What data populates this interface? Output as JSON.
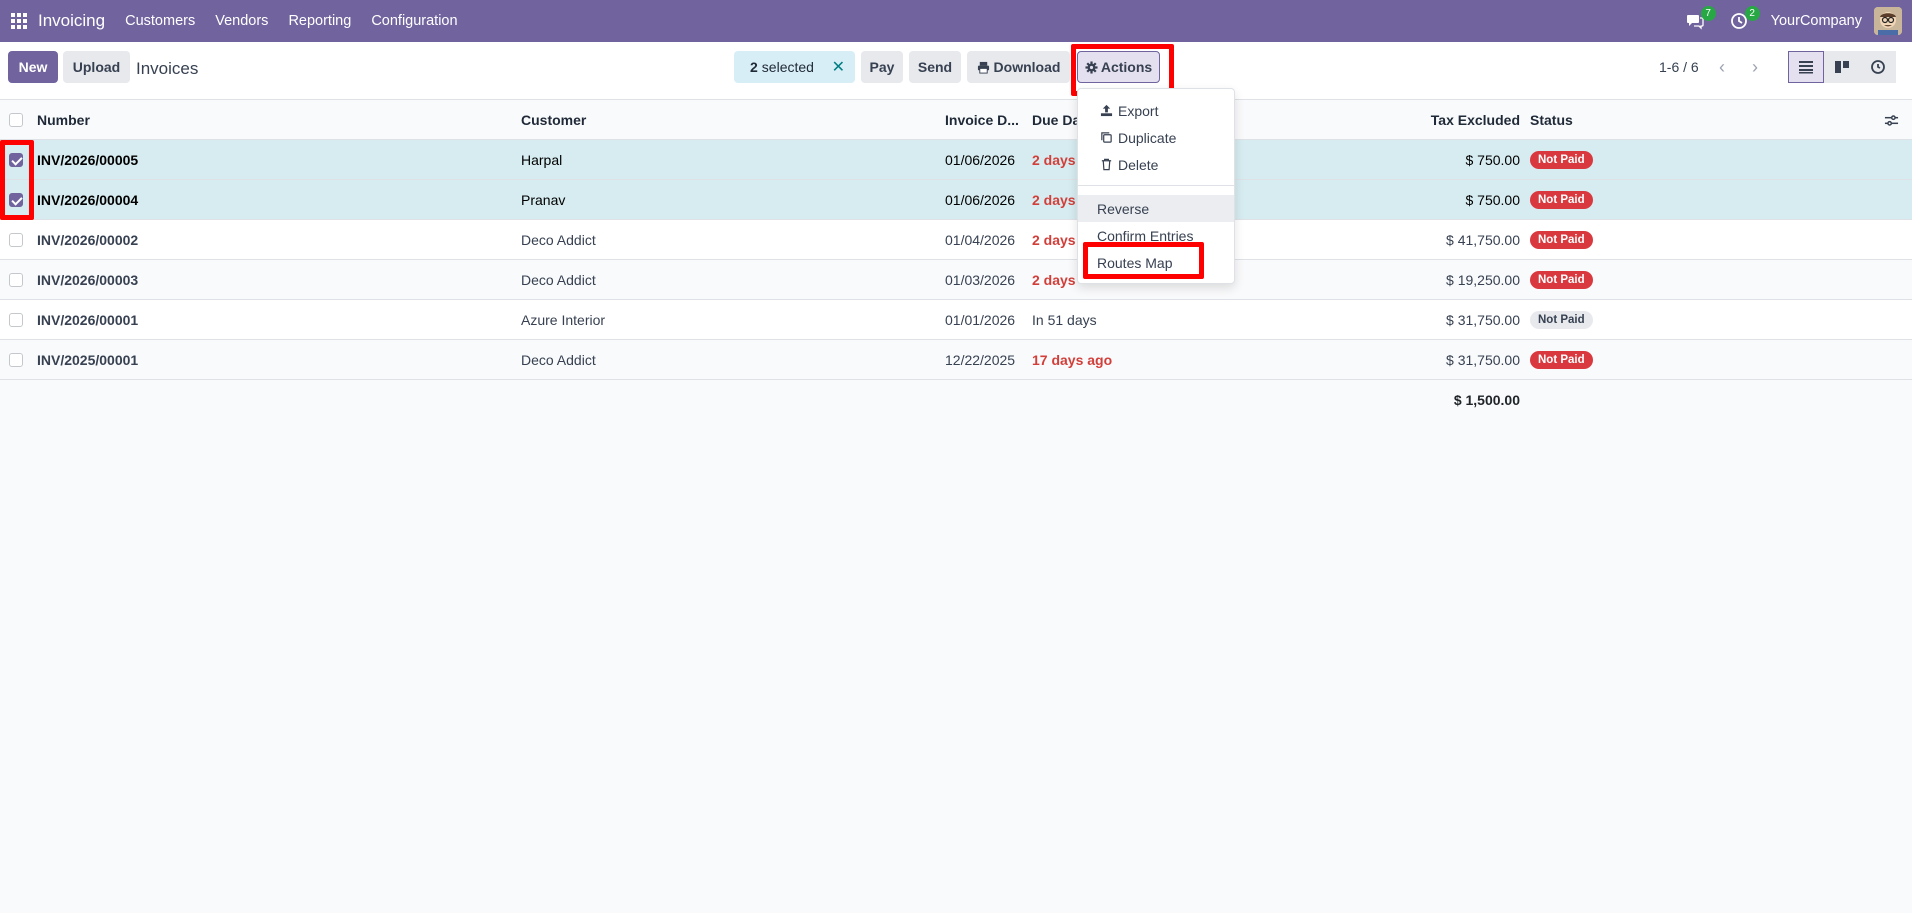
{
  "navbar": {
    "brand": "Invoicing",
    "menu": [
      "Customers",
      "Vendors",
      "Reporting",
      "Configuration"
    ],
    "messages_count": "7",
    "activities_count": "2",
    "company": "YourCompany"
  },
  "control": {
    "new_label": "New",
    "upload_label": "Upload",
    "title": "Invoices",
    "selected_count": "2",
    "selected_text": "selected",
    "pay_label": "Pay",
    "send_label": "Send",
    "download_label": "Download",
    "actions_label": "Actions",
    "pager": "1-6 / 6"
  },
  "table": {
    "headers": {
      "number": "Number",
      "customer": "Customer",
      "invoice_date": "Invoice D...",
      "due_date": "Due Da",
      "tax_excluded": "Tax Excluded",
      "status": "Status"
    },
    "rows": [
      {
        "number": "INV/2026/00005",
        "customer": "Harpal",
        "invoice_date": "01/06/2026",
        "due": "2 days",
        "tax": "$ 750.00",
        "status": "Not Paid",
        "checked": true
      },
      {
        "number": "INV/2026/00004",
        "customer": "Pranav",
        "invoice_date": "01/06/2026",
        "due": "2 days",
        "tax": "$ 750.00",
        "status": "Not Paid",
        "checked": true
      },
      {
        "number": "INV/2026/00002",
        "customer": "Deco Addict",
        "invoice_date": "01/04/2026",
        "due": "2 days",
        "tax": "$ 41,750.00",
        "status": "Not Paid",
        "checked": false
      },
      {
        "number": "INV/2026/00003",
        "customer": "Deco Addict",
        "invoice_date": "01/03/2026",
        "due": "2 days",
        "tax": "$ 19,250.00",
        "status": "Not Paid",
        "checked": false
      },
      {
        "number": "INV/2026/00001",
        "customer": "Azure Interior",
        "invoice_date": "01/01/2026",
        "due": "In 51 days",
        "tax": "$ 31,750.00",
        "status": "Not Paid",
        "checked": false
      },
      {
        "number": "INV/2025/00001",
        "customer": "Deco Addict",
        "invoice_date": "12/22/2025",
        "due": "17 days ago",
        "tax": "$ 31,750.00",
        "status": "Not Paid",
        "checked": false
      }
    ],
    "total": "$ 1,500.00"
  },
  "actions_menu": {
    "export": "Export",
    "duplicate": "Duplicate",
    "delete": "Delete",
    "reverse": "Reverse",
    "confirm_entries": "Confirm Entries",
    "routes_map": "Routes Map"
  },
  "colors": {
    "brand": "#71639e",
    "highlight": "#ff0000",
    "danger": "#d9383e",
    "selected_row": "#d6ecf0"
  }
}
